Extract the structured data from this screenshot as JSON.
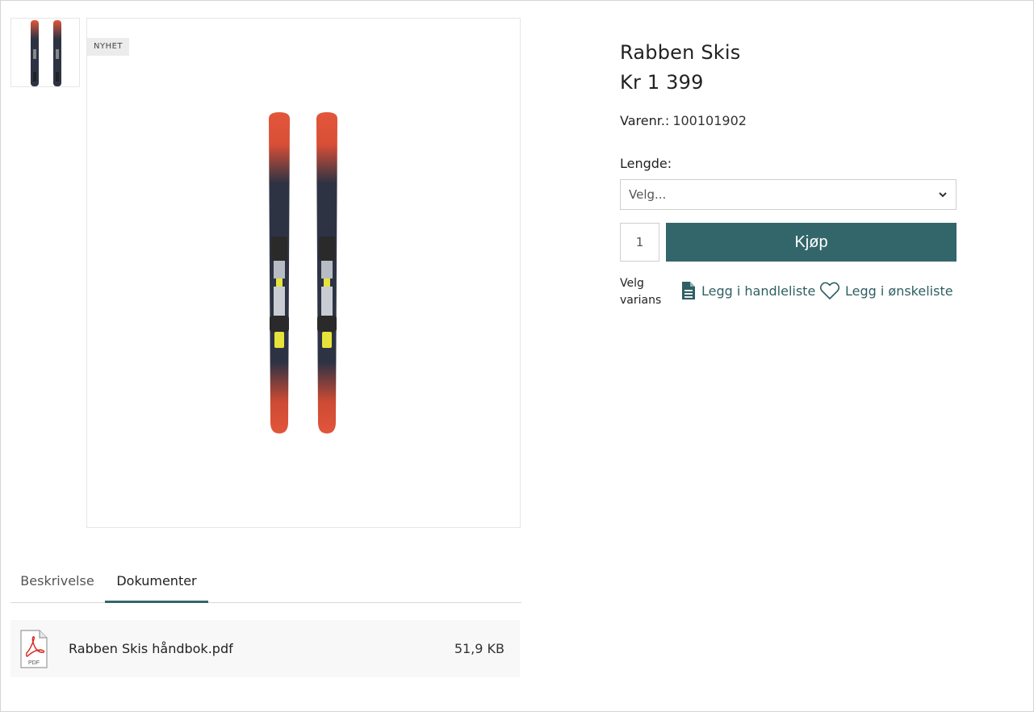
{
  "product": {
    "badge": "NYHET",
    "title": "Rabben Skis",
    "price": "Kr 1 399",
    "sku_label": "Varenr.:",
    "sku_value": "100101902"
  },
  "variant": {
    "label": "Lengde:",
    "placeholder": "Velg..."
  },
  "purchase": {
    "quantity": "1",
    "buy_label": "Kjøp",
    "hint_line1": "Velg",
    "hint_line2": "varians"
  },
  "actions": {
    "shopping_list": "Legg i handleliste",
    "wishlist": "Legg i ønskeliste"
  },
  "tabs": [
    {
      "label": "Beskrivelse",
      "active": false
    },
    {
      "label": "Dokumenter",
      "active": true
    }
  ],
  "documents": [
    {
      "icon": "pdf-file-icon",
      "badge": "PDF",
      "name": "Rabben Skis håndbok.pdf",
      "size": "51,9 KB"
    }
  ],
  "colors": {
    "accent": "#33666a",
    "ski_red": "#e2563b",
    "ski_navy": "#2e3344",
    "binding_yellow": "#e6e33a"
  },
  "icons": {
    "chevron": "chevron-down-icon",
    "shopping_list": "document-list-icon",
    "wishlist": "heart-icon"
  }
}
